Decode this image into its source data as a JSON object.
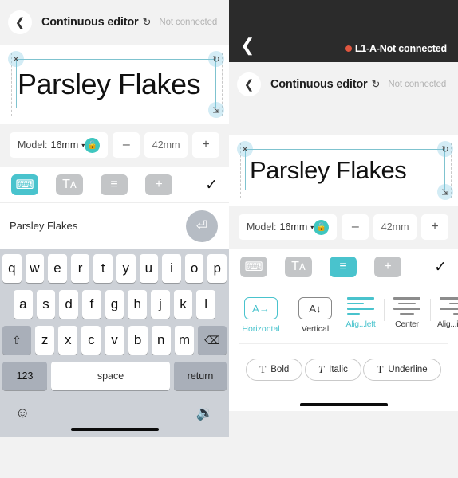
{
  "left": {
    "appbar": {
      "back_icon": "chevron-left-icon",
      "title": "Continuous editor",
      "sync_icon": "sync-icon",
      "status": "Not connected"
    },
    "canvas": {
      "text": "Parsley Flakes",
      "close_handle": "×",
      "rotate_handle": "⟳",
      "resize_handle": "⤡"
    },
    "model_row": {
      "label": "Model:",
      "value": "16mm",
      "caret": "▾",
      "lock_icon": "lock-open-icon",
      "minus": "–",
      "size": "42mm",
      "plus": "+"
    },
    "toolbar": {
      "tools": [
        {
          "name": "keyboard-tool",
          "glyph": "⌨",
          "active": true
        },
        {
          "name": "font-tool",
          "glyph": "Tᴀ",
          "active": false
        },
        {
          "name": "align-tool",
          "glyph": "≡",
          "active": false
        },
        {
          "name": "add-tool",
          "glyph": "+",
          "active": false
        }
      ],
      "confirm": "✓"
    },
    "text_row": {
      "value": "Parsley Flakes",
      "enter_glyph": "⏎"
    },
    "keyboard": {
      "row1": [
        "q",
        "w",
        "e",
        "r",
        "t",
        "y",
        "u",
        "i",
        "o",
        "p"
      ],
      "row2": [
        "a",
        "s",
        "d",
        "f",
        "g",
        "h",
        "j",
        "k",
        "l"
      ],
      "row3": [
        "z",
        "x",
        "c",
        "v",
        "b",
        "n",
        "m"
      ],
      "shift": "⇧",
      "backspace": "⌫",
      "numbers": "123",
      "space": "space",
      "return": "return",
      "emoji": "☺",
      "mic": "🎤"
    }
  },
  "right": {
    "dark_header": {
      "back_icon": "chevron-left-icon",
      "status": "L1-A-Not connected",
      "dot_color": "#e0563f"
    },
    "appbar": {
      "back_icon": "chevron-left-icon",
      "title": "Continuous editor",
      "sync_icon": "sync-icon",
      "status": "Not connected"
    },
    "canvas": {
      "text": "Parsley Flakes"
    },
    "model_row": {
      "label": "Model:",
      "value": "16mm",
      "caret": "▾",
      "minus": "–",
      "size": "42mm",
      "plus": "+"
    },
    "toolbar": {
      "tools": [
        {
          "name": "keyboard-tool",
          "glyph": "⌨",
          "active": false
        },
        {
          "name": "font-tool",
          "glyph": "Tᴀ",
          "active": false
        },
        {
          "name": "align-tool",
          "glyph": "≡",
          "active": true
        },
        {
          "name": "add-tool",
          "glyph": "+",
          "active": false
        }
      ],
      "confirm": "✓"
    },
    "align_panel": {
      "orientation": [
        {
          "glyph": "A→",
          "label": "Horizontal",
          "active": true
        },
        {
          "glyph": "A↓",
          "label": "Vertical",
          "active": false
        }
      ],
      "alignment": [
        {
          "label": "Alig...left",
          "active": true
        },
        {
          "label": "Center",
          "active": false
        },
        {
          "label": "Alig...ight",
          "active": false
        }
      ],
      "styles": [
        {
          "glyph": "T",
          "label": "Bold"
        },
        {
          "glyph": "T",
          "label": "Italic"
        },
        {
          "glyph": "T",
          "label": "Underline"
        }
      ]
    }
  },
  "colors": {
    "accent": "#49c3cd",
    "lock": "#3fc6bf",
    "dark": "#2b2b2b",
    "page_bg": "#f2f2f2"
  }
}
